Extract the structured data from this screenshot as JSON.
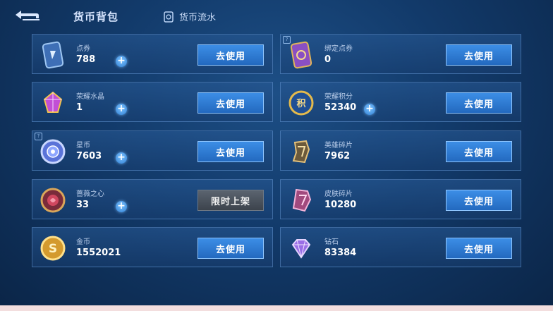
{
  "header": {
    "title": "货币背包",
    "flow_label": "货币流水"
  },
  "currencies": [
    {
      "name": "点券",
      "amount": "788",
      "button": "去使用"
    },
    {
      "name": "绑定点券",
      "amount": "0",
      "button": "去使用"
    },
    {
      "name": "荣耀水晶",
      "amount": "1",
      "button": "去使用"
    },
    {
      "name": "荣耀积分",
      "amount": "52340",
      "button": "去使用"
    },
    {
      "name": "星币",
      "amount": "7603",
      "button": "去使用"
    },
    {
      "name": "英雄碎片",
      "amount": "7962",
      "button": "去使用"
    },
    {
      "name": "蔷薇之心",
      "amount": "33",
      "button": "限时上架"
    },
    {
      "name": "皮肤碎片",
      "amount": "10280",
      "button": "去使用"
    },
    {
      "name": "金币",
      "amount": "1552021",
      "button": "去使用"
    },
    {
      "name": "钻石",
      "amount": "83384",
      "button": "去使用"
    }
  ],
  "colors": {
    "accent": "#2f7fd4",
    "panel_border": "#6ea0dc",
    "disabled": "#4a525c"
  }
}
